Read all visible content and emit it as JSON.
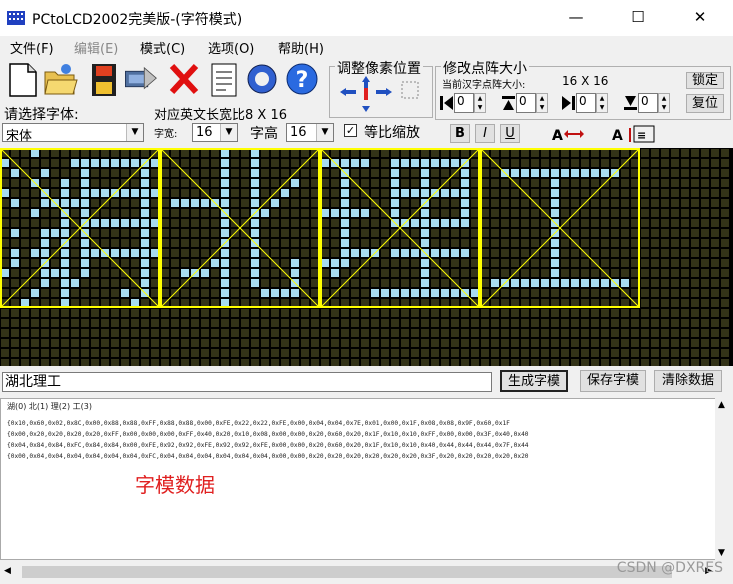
{
  "window": {
    "title": "PCtoLCD2002完美版-(字符模式)",
    "minimize": "—",
    "maximize": "☐",
    "close": "✕"
  },
  "menu": [
    "文件(F)",
    "编辑(E)",
    "模式(C)",
    "选项(O)",
    "帮助(H)"
  ],
  "font_panel": {
    "choose_font_label": "请选择字体:",
    "font_value": "宋体",
    "width_label": "对应英文长宽比8 X 16",
    "char_width_label": "字宽:",
    "char_width_value": "16",
    "char_height_label": "字高",
    "char_height_value": "16",
    "proportional_label": "等比缩放",
    "proportional_checked": true,
    "bold": "B",
    "italic": "I",
    "underline": "U"
  },
  "pixel_adjust": {
    "title": "调整像素位置"
  },
  "matrix_size": {
    "title": "修改点阵大小",
    "current_label": "当前汉字点阵大小:",
    "current_value": "16 X 16",
    "lock": "锁定",
    "reset": "复位",
    "spin_values": [
      "0",
      "0",
      "0",
      "0"
    ]
  },
  "input": {
    "text": "湖北理工",
    "generate": "生成字模",
    "save": "保存字模",
    "clear": "清除数据"
  },
  "output": {
    "index_line": "湖(0) 北(1) 理(2) 工(3)",
    "lines": [
      "{0x10,0x60,0x02,0x8C,0x00,0x88,0x88,0xFF,0x88,0x88,0x00,0xFE,0x22,0x22,0xFE,0x00,0x04,0x04,0x7E,0x01,0x00,0x1F,0x08,0x08,0x9F,0x60,0x1F",
      "{0x00,0x20,0x20,0x20,0x20,0xFF,0x00,0x00,0x00,0xFF,0x40,0x20,0x10,0x08,0x00,0x00,0x20,0x60,0x20,0x1F,0x10,0x10,0xFF,0x00,0x00,0x3F,0x40,0x40",
      "{0x04,0x84,0x84,0xFC,0x84,0x84,0x00,0xFE,0x92,0x92,0xFE,0x92,0x92,0xFE,0x00,0x00,0x20,0x60,0x20,0x1F,0x10,0x10,0x40,0x44,0x44,0x44,0x7F,0x44",
      "{0x00,0x04,0x04,0x04,0x04,0x04,0x04,0xFC,0x04,0x04,0x04,0x04,0x04,0x04,0x00,0x00,0x20,0x20,0x20,0x20,0x20,0x20,0x3F,0x20,0x20,0x20,0x20,0x20"
    ],
    "caption": "字模数据"
  },
  "watermark": "CSDN @DXRES",
  "colors": {
    "lit_pixel": "#a8dcf0",
    "unlit_pixel": "#333318",
    "char_border": "#ffff00",
    "caption": "#e02020"
  },
  "matrix": {
    "glyphs": [
      [
        "0001000000000000",
        "1000000111111111",
        "0100100010000010",
        "0001001010000010",
        "1000101011111111",
        "0100111110000010",
        "0001001010000010",
        "0000001011111111",
        "0100111010000010",
        "0000101010000010",
        "0101101011111111",
        "0100101010000010",
        "1000111010000010",
        "0000101100000010",
        "0001001000001010",
        "0010001000000100"
      ],
      [
        "0000001001000000",
        "0000001001000000",
        "0000001001000000",
        "0000001001000100",
        "0000001001001000",
        "0111111001010000",
        "0000001001100000",
        "0000001001000000",
        "0000001001000000",
        "0000001001000000",
        "0000001001000000",
        "0000011001000100",
        "0011101001000100",
        "0000001001000100",
        "0000001000111100",
        "0000001000000000"
      ],
      [
        "0000000000000000",
        "1111100111111110",
        "0010000100100010",
        "0010000100100010",
        "0010000111111110",
        "0010000100100010",
        "1111100100100010",
        "0010000111111110",
        "0010000000100000",
        "0010000000100000",
        "0011110111111110",
        "1110000000100000",
        "0100000000100000",
        "0000000000100000",
        "0000011111111111",
        "0000000000000000"
      ],
      [
        "0000000000000000",
        "0000000000000000",
        "0011111111111100",
        "0000000100000000",
        "0000000100000000",
        "0000000100000000",
        "0000000100000000",
        "0000000100000000",
        "0000000100000000",
        "0000000100000000",
        "0000000100000000",
        "0000000100000000",
        "0000000100000000",
        "0111111111111110",
        "0000000000000000",
        "0000000000000000"
      ]
    ]
  }
}
